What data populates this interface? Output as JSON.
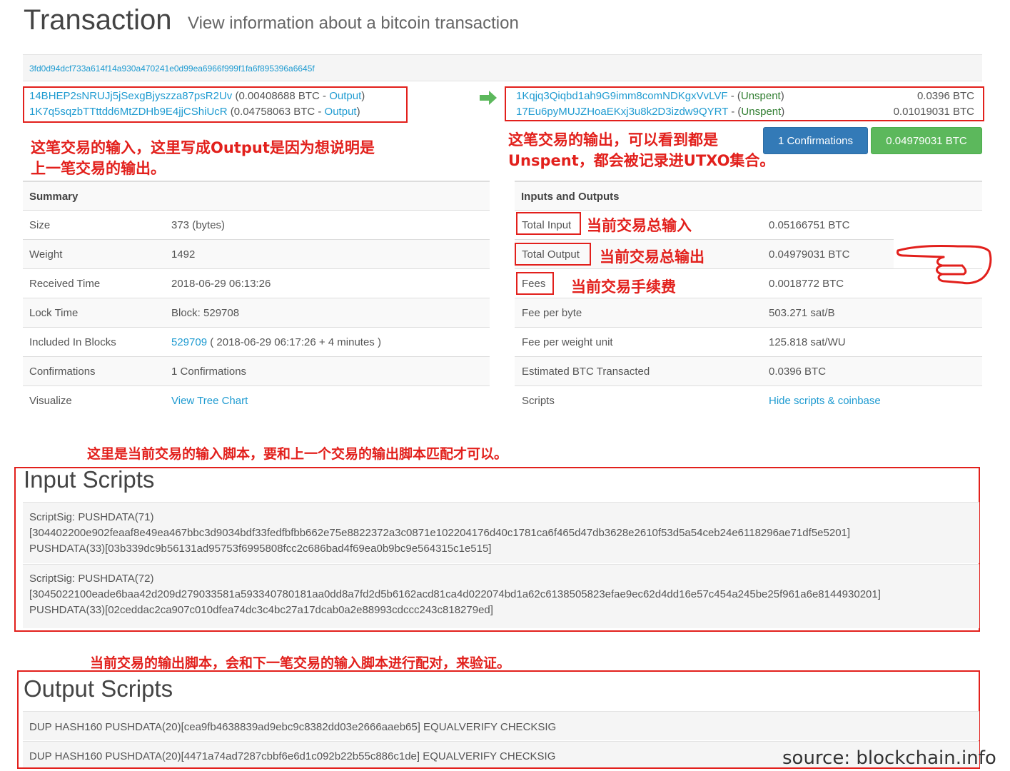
{
  "header": {
    "title": "Transaction",
    "subtitle": "View information about a bitcoin transaction"
  },
  "tx_hash": "3fd0d94dcf733a614f14a930a470241e0d99ea6966f999f1fa6f895396a6645f",
  "inputs": [
    {
      "address": "14BHEP2sNRUJj5jSexgBjyszza87psR2Uv",
      "amount": " (0.00408688 BTC - ",
      "link": "Output",
      "close": ")"
    },
    {
      "address": "1K7q5sqzbTTttdd6MtZDHb9E4jjCShiUcR",
      "amount": " (0.04758063 BTC - ",
      "link": "Output",
      "close": ")"
    }
  ],
  "outputs": [
    {
      "address": "1Kqjq3Qiqbd1ah9G9imm8comNDKgxVvLVF",
      "sep": " - (",
      "status": "Unspent",
      "close": ")",
      "value": "0.0396 BTC"
    },
    {
      "address": "17Eu6pyMUJZHoaEKxj3u8k2D3izdw9QYRT",
      "sep": " - (",
      "status": "Unspent",
      "close": ")",
      "value": "0.01019031 BTC"
    }
  ],
  "buttons": {
    "confirmations": "1 Confirmations",
    "total": "0.04979031 BTC"
  },
  "summary": {
    "heading": "Summary",
    "rows": [
      {
        "label": "Size",
        "value": "373 (bytes)"
      },
      {
        "label": "Weight",
        "value": "1492"
      },
      {
        "label": "Received Time",
        "value": "2018-06-29 06:13:26"
      },
      {
        "label": "Lock Time",
        "value": "Block: 529708"
      },
      {
        "label": "Included In Blocks",
        "link": "529709",
        "value": " ( 2018-06-29 06:17:26 + 4 minutes )"
      },
      {
        "label": "Confirmations",
        "value": "1 Confirmations"
      },
      {
        "label": "Visualize",
        "link": "View Tree Chart"
      }
    ]
  },
  "io_table": {
    "heading": "Inputs and Outputs",
    "rows": [
      {
        "label": "Total Input",
        "value": "0.05166751 BTC"
      },
      {
        "label": "Total Output",
        "value": "0.04979031 BTC"
      },
      {
        "label": "Fees",
        "value": "0.0018772 BTC"
      },
      {
        "label": "Fee per byte",
        "value": "503.271 sat/B"
      },
      {
        "label": "Fee per weight unit",
        "value": "125.818 sat/WU"
      },
      {
        "label": "Estimated BTC Transacted",
        "value": "0.0396 BTC"
      },
      {
        "label": "Scripts",
        "link": "Hide scripts & coinbase"
      }
    ]
  },
  "input_scripts": {
    "title": "Input Scripts",
    "blocks": [
      {
        "line1": "ScriptSig: PUSHDATA(71)",
        "line2": "[304402200e902feaaf8e49ea467bbc3d9034bdf33fedfbfbb662e75e8822372a3c0871e102204176d40c1781ca6f465d47db3628e2610f53d5a54ceb24e6118296ae71df5e5201]",
        "line3": "PUSHDATA(33)[03b339dc9b56131ad95753f6995808fcc2c686bad4f69ea0b9bc9e564315c1e515]"
      },
      {
        "line1": "ScriptSig: PUSHDATA(72)",
        "line2": "[3045022100eade6baa42d209d279033581a593340780181aa0dd8a7fd2d5b6162acd81ca4d022074bd1a62c6138505823efae9ec62d4dd16e57c454a245be25f961a6e8144930201]",
        "line3": "PUSHDATA(33)[02ceddac2ca907c010dfea74dc3c4bc27a17dcab0a2e88993cdccc243c818279ed]"
      }
    ]
  },
  "output_scripts": {
    "title": "Output Scripts",
    "lines": [
      "DUP HASH160 PUSHDATA(20)[cea9fb4638839ad9ebc9c8382dd03e2666aaeb65] EQUALVERIFY CHECKSIG",
      "DUP HASH160 PUSHDATA(20)[4471a74ad7287cbbf6e6d1c092b22b55c886c1de] EQUALVERIFY CHECKSIG"
    ]
  },
  "annotations": {
    "inputs_note_1": "这笔交易的输入，这里写成Output是因为想说明是",
    "inputs_note_2": "上一笔交易的输出。",
    "outputs_note_1": "这笔交易的输出，可以看到都是",
    "outputs_note_2": "Unspent，都会被记录进UTXO集合。",
    "total_input_note": "当前交易总输入",
    "total_output_note": "当前交易总输出",
    "fees_note": "当前交易手续费",
    "input_scripts_note": "这里是当前交易的输入脚本，要和上一个交易的输出脚本匹配才可以。",
    "output_scripts_note": "当前交易的输出脚本，会和下一笔交易的输入脚本进行配对，来验证。"
  },
  "source": "source: blockchain.info",
  "colors": {
    "link": "#1f9bd1",
    "annotation_red": "#e2201c",
    "unspent_green": "#2f7d2f",
    "btn_blue": "#337ab7",
    "btn_green": "#5cb85c"
  },
  "icons": {
    "arrow": "right-arrow-icon",
    "hand": "pointing-hand-icon"
  }
}
